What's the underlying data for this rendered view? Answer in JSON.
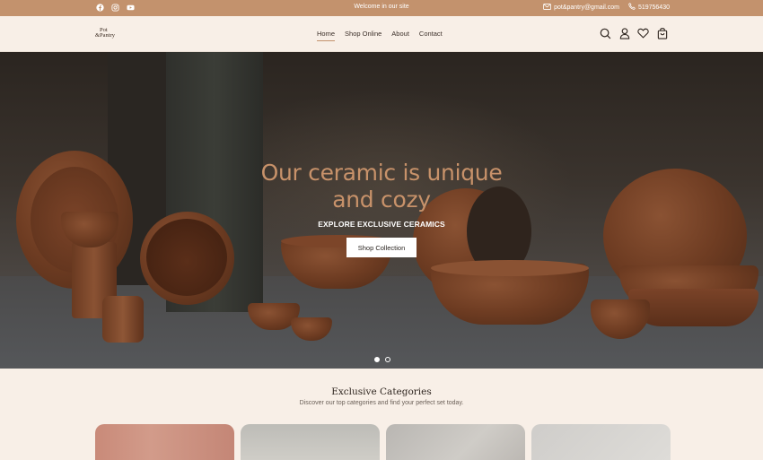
{
  "topbar": {
    "social_icons": [
      "facebook-icon",
      "instagram-icon",
      "youtube-icon"
    ],
    "welcome": "Welcome in our site",
    "email": "pot&pantry@gmail.com",
    "phone": "519756430"
  },
  "header": {
    "logo_line1": "Pot",
    "logo_line2": "&Pantry",
    "menu": [
      {
        "label": "Home",
        "active": true
      },
      {
        "label": "Shop Online",
        "active": false
      },
      {
        "label": "About",
        "active": false
      },
      {
        "label": "Contact",
        "active": false
      }
    ],
    "icons": [
      "search-icon",
      "user-icon",
      "heart-icon",
      "cart-icon"
    ]
  },
  "hero": {
    "title_line1": "Our ceramic is unique",
    "title_line2": "and cozy",
    "subtitle": "EXPLORE EXCLUSIVE CERAMICS",
    "button": "Shop Collection",
    "slides": 2,
    "active_slide": 1
  },
  "categories": {
    "title": "Exclusive Categories",
    "description": "Discover our top categories and find your perfect set today."
  },
  "colors": {
    "accent": "#c3926d",
    "background": "#f8efe7",
    "hero_title": "#c8926a"
  }
}
